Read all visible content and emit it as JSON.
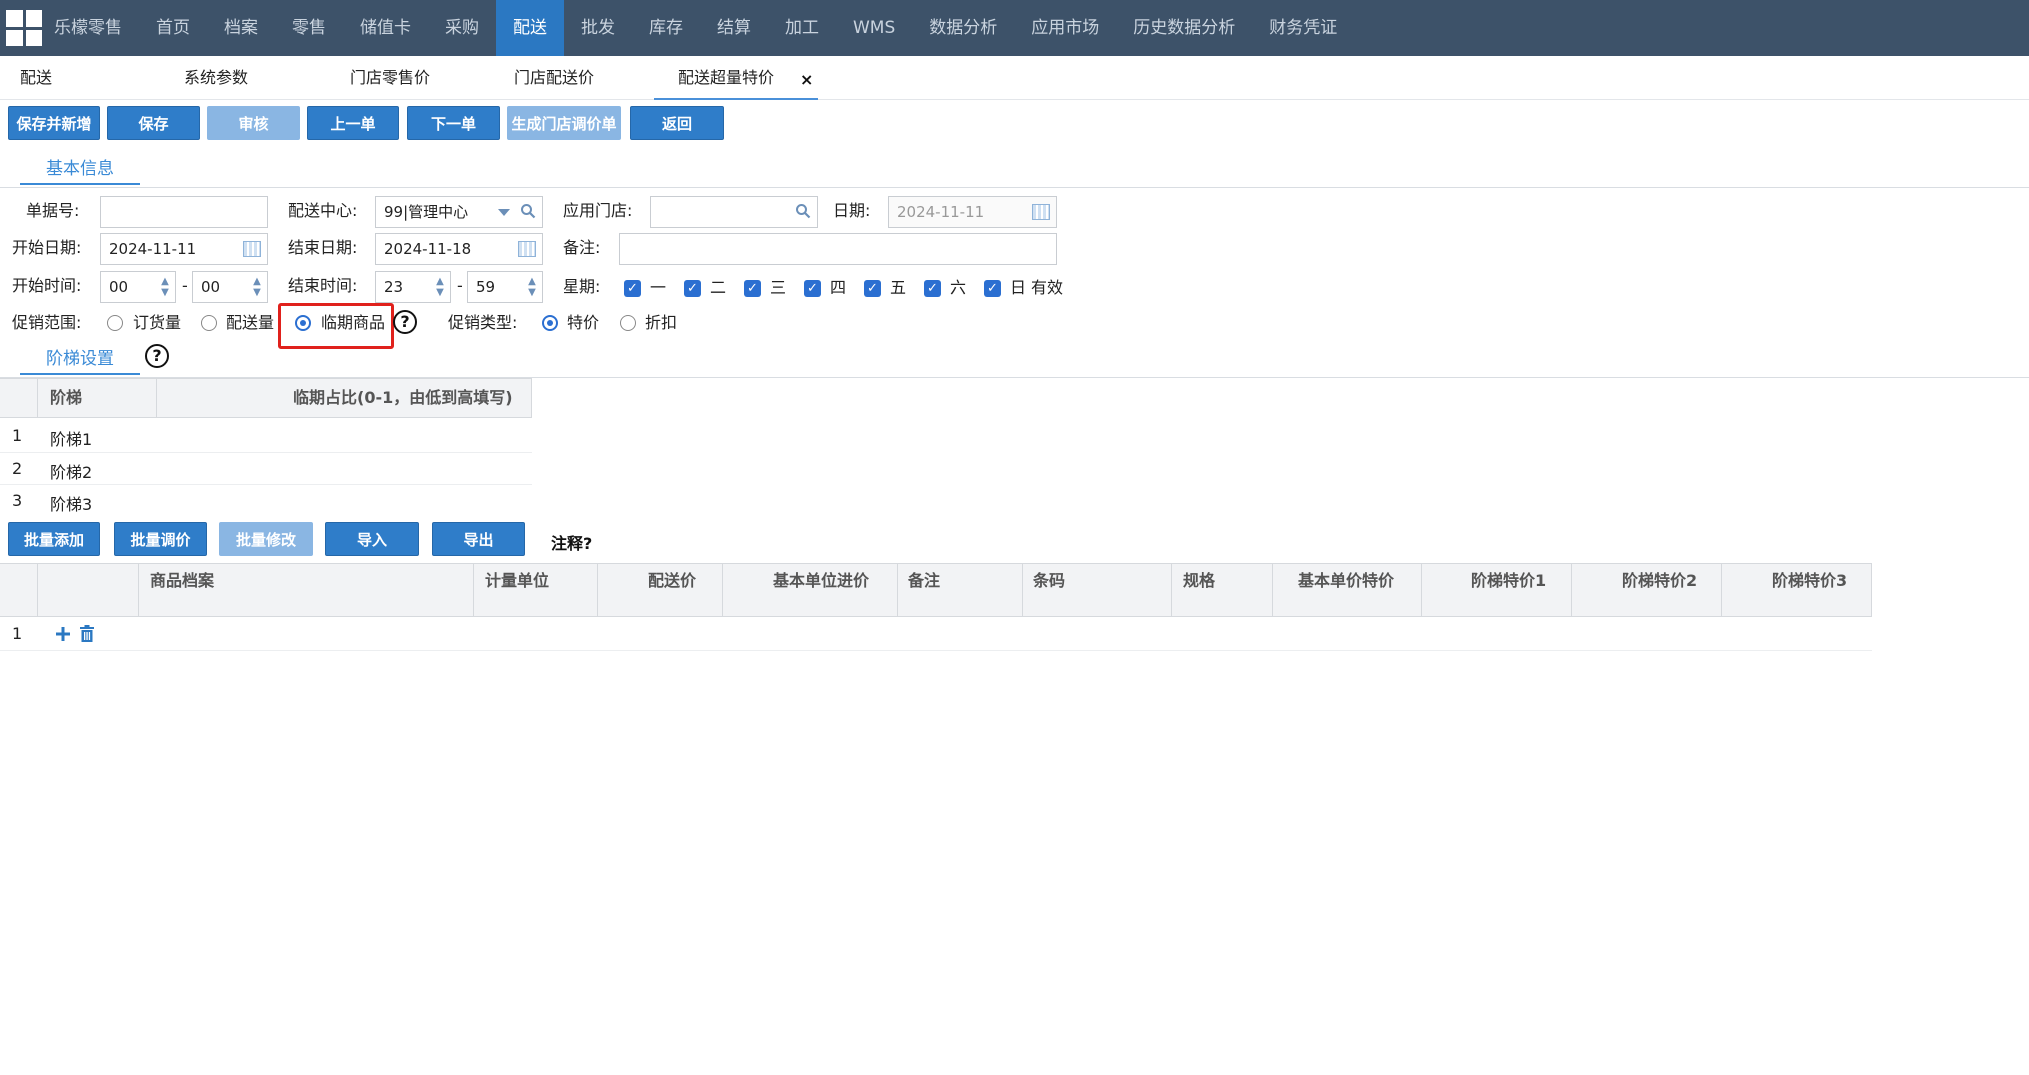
{
  "nav": {
    "brand": "乐檬零售",
    "items": [
      "首页",
      "档案",
      "零售",
      "储值卡",
      "采购",
      "配送",
      "批发",
      "库存",
      "结算",
      "加工",
      "WMS",
      "数据分析",
      "应用市场",
      "历史数据分析",
      "财务凭证"
    ],
    "active": "配送"
  },
  "tabs": [
    "配送",
    "系统参数",
    "门店零售价",
    "门店配送价",
    "配送超量特价"
  ],
  "tab_close": "×",
  "toolbar": [
    "保存并新增",
    "保存",
    "审核",
    "上一单",
    "下一单",
    "生成门店调价单",
    "返回"
  ],
  "sections": {
    "basic": "基本信息",
    "tier": "阶梯设置"
  },
  "form": {
    "doc_no_label": "单据号:",
    "dist_center_label": "配送中心:",
    "dist_center_value": "99|管理中心",
    "store_label": "应用门店:",
    "date_label": "日期:",
    "date_value": "2024-11-11",
    "start_date_label": "开始日期:",
    "start_date_value": "2024-11-11",
    "end_date_label": "结束日期:",
    "end_date_value": "2024-11-18",
    "remark_label": "备注:",
    "start_time_label": "开始时间:",
    "start_hour": "00",
    "start_min": "00",
    "end_time_label": "结束时间:",
    "end_hour": "23",
    "end_min": "59",
    "dash": "-",
    "week_label": "星期:",
    "weekdays": [
      "一",
      "二",
      "三",
      "四",
      "五",
      "六",
      "日"
    ],
    "valid": "有效",
    "scope_label": "促销范围:",
    "scope_options": [
      "订货量",
      "配送量",
      "临期商品"
    ],
    "type_label": "促销类型:",
    "type_options": [
      "特价",
      "折扣"
    ],
    "help": "?"
  },
  "tier_table": {
    "headers": [
      "阶梯",
      "临期占比(0-1，由低到高填写)"
    ],
    "rows": [
      {
        "no": "1",
        "name": "阶梯1"
      },
      {
        "no": "2",
        "name": "阶梯2"
      },
      {
        "no": "3",
        "name": "阶梯3"
      }
    ]
  },
  "batch_buttons": [
    "批量添加",
    "批量调价",
    "批量修改",
    "导入",
    "导出"
  ],
  "note": "注释?",
  "product_table": {
    "headers": [
      "商品档案",
      "计量单位",
      "配送价",
      "基本单位进价",
      "备注",
      "条码",
      "规格",
      "基本单价特价",
      "阶梯特价1",
      "阶梯特价2",
      "阶梯特价3"
    ],
    "rows": [
      {
        "no": "1"
      }
    ]
  },
  "colors": {
    "nav_bg": "#3d5269",
    "nav_active": "#2b78c2",
    "button": "#2f7dc9",
    "button_disabled": "#8ab6e3",
    "highlight": "#e0211c"
  }
}
